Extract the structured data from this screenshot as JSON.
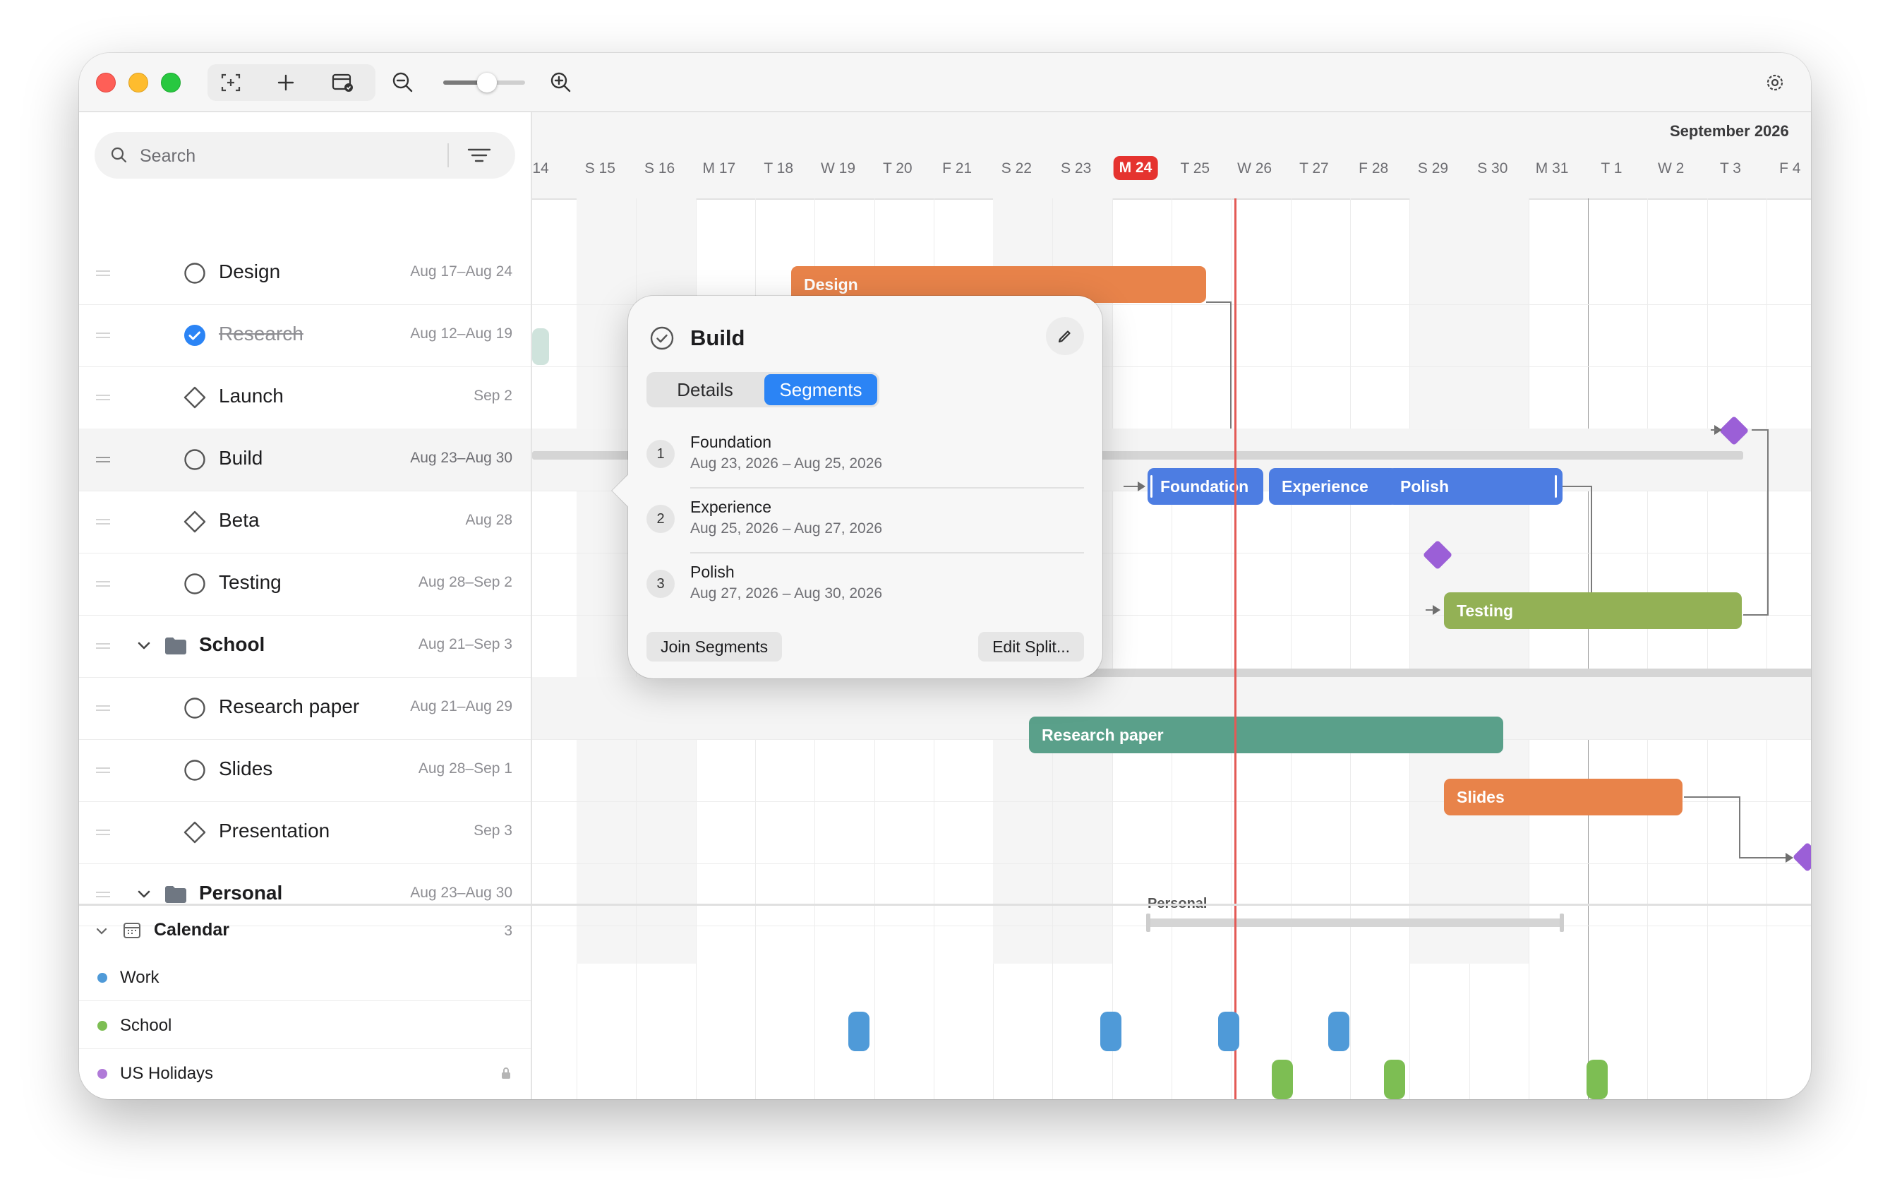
{
  "search": {
    "placeholder": "Search"
  },
  "tasks": [
    {
      "name": "Design",
      "date": "Aug 17–Aug 24"
    },
    {
      "name": "Research",
      "date": "Aug 12–Aug 19"
    },
    {
      "name": "Launch",
      "date": "Sep 2"
    },
    {
      "name": "Build",
      "date": "Aug 23–Aug 30"
    },
    {
      "name": "Beta",
      "date": "Aug 28"
    },
    {
      "name": "Testing",
      "date": "Aug 28–Sep 2"
    },
    {
      "name": "School",
      "date": "Aug 21–Sep 3"
    },
    {
      "name": "Research paper",
      "date": "Aug 21–Aug 29"
    },
    {
      "name": "Slides",
      "date": "Aug 28–Sep 1"
    },
    {
      "name": "Presentation",
      "date": "Sep 3"
    },
    {
      "name": "Personal",
      "date": "Aug 23–Aug 30"
    }
  ],
  "calendar": {
    "title": "Calendar",
    "count": "3",
    "items": [
      {
        "label": "Work",
        "color": "#4f9ad8"
      },
      {
        "label": "School",
        "color": "#7dbe53"
      },
      {
        "label": "US Holidays",
        "color": "#b07ad8"
      }
    ]
  },
  "timeline": {
    "month": "September 2026",
    "days": [
      "14",
      "S 15",
      "S 16",
      "M 17",
      "T 18",
      "W 19",
      "T 20",
      "F 21",
      "S 22",
      "S 23",
      "M 24",
      "T 25",
      "W 26",
      "T 27",
      "F 28",
      "S 29",
      "S 30",
      "M 31",
      "T 1",
      "W 2",
      "T 3",
      "F 4"
    ],
    "today": "M 24"
  },
  "bars": {
    "design": "Design",
    "foundation": "Foundation",
    "experience": "Experience",
    "polish": "Polish",
    "testing": "Testing",
    "research_paper": "Research paper",
    "slides": "Slides",
    "personal": "Personal"
  },
  "popover": {
    "title": "Build",
    "tabs": [
      "Details",
      "Segments"
    ],
    "active_tab": "Segments",
    "segments": [
      {
        "num": "1",
        "name": "Foundation",
        "range": "Aug 23, 2026 – Aug 25, 2026"
      },
      {
        "num": "2",
        "name": "Experience",
        "range": "Aug 25, 2026 – Aug 27, 2026"
      },
      {
        "num": "3",
        "name": "Polish",
        "range": "Aug 27, 2026 – Aug 30, 2026"
      }
    ],
    "join_label": "Join Segments",
    "edit_label": "Edit Split..."
  },
  "colors": {
    "accent": "#2b84f5",
    "today": "#e5332f",
    "work_bar": "#e8834a",
    "testing_bar": "#93b155",
    "school_bar": "#5aa08a",
    "build_segments": "#4d7de2",
    "milestone": "#9b5fd7"
  }
}
